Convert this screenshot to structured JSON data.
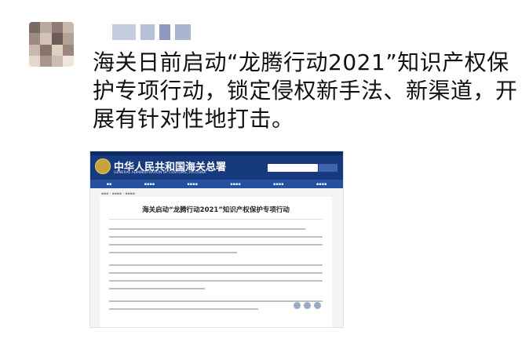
{
  "post": {
    "text": "海关日前启动“龙腾行动2021”知识产权保护专项行动，锁定侵权新手法、新渠道，开展有针对性地打击。"
  },
  "screenshot": {
    "site_title": "中华人民共和国海关总署",
    "site_subtitle": "GENERAL ADMINISTRATION OF CUSTOMS, P.R.CHINA",
    "article_title": "海关启动“龙腾行动2021”知识产权保护专项行动"
  },
  "icons": {
    "avatar": "avatar-icon",
    "emblem": "national-emblem-icon",
    "share": "share-icon"
  },
  "colors": {
    "header_blue": "#17397e",
    "nav_blue": "#24519f",
    "text": "#111111"
  }
}
